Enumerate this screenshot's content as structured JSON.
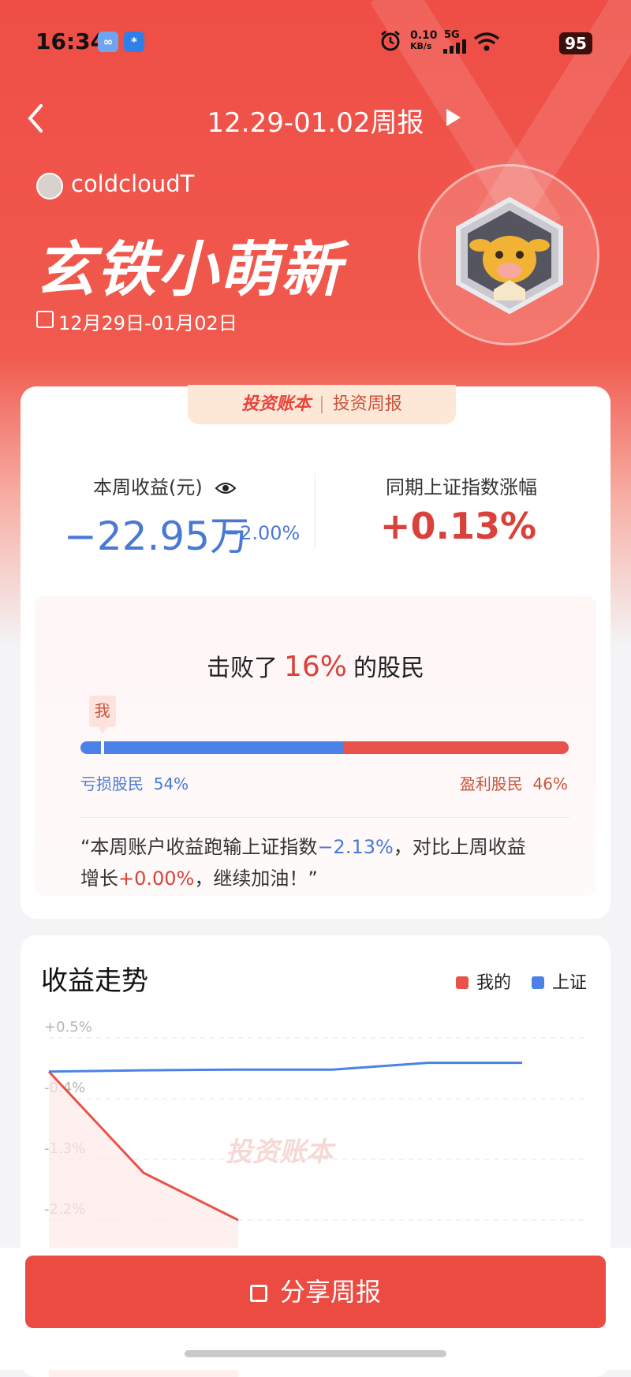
{
  "status_bar": {
    "time": "16:34",
    "net_speed_value": "0.10",
    "net_speed_unit": "KB/s",
    "network": "5G",
    "battery": "95"
  },
  "nav": {
    "title": "12.29-01.02周报"
  },
  "profile": {
    "username": "coldcloudT",
    "rank": "玄铁小萌新",
    "date_range": "12月29日-01月02日"
  },
  "summary": {
    "tag_logo": "投资账本",
    "tag_label": "投资周报",
    "week_profit_label": "本周收益(元)",
    "week_profit": "−22.95万",
    "week_profit_pct": "−2.00%",
    "index_label": "同期上证指数涨幅",
    "index_change": "+0.13%"
  },
  "beat": {
    "prefix": "击败了",
    "pct": "16%",
    "suffix": "的股民",
    "me_label": "我",
    "loss_label": "亏损股民",
    "loss_pct": "54%",
    "gain_label": "盈利股民",
    "gain_pct": "46%",
    "loss_fraction": 0.54,
    "me_position_fraction": 0.16
  },
  "quote": {
    "part1": "“本周账户收益跑输上证指数",
    "diff": "−2.13%",
    "part2": "，对比上周收益",
    "part3": "增长",
    "growth": "+0.00%",
    "part4": "，继续加油！”"
  },
  "trend": {
    "title": "收益走势",
    "legend_mine": "我的",
    "legend_sse": "上证",
    "watermark": "投资账本"
  },
  "chart_data": {
    "type": "line",
    "x": [
      0,
      1,
      2,
      3,
      4,
      5
    ],
    "ytick_labels": [
      "+0.5%",
      "-0.4%",
      "-1.3%",
      "-2.2%"
    ],
    "ytick_values": [
      0.5,
      -0.4,
      -1.3,
      -2.2
    ],
    "series": [
      {
        "name": "我的",
        "color": "#e8524a",
        "values": [
          -0.0,
          -1.5,
          -2.2
        ]
      },
      {
        "name": "上证",
        "color": "#4c82e8",
        "values": [
          -0.0,
          0.02,
          0.03,
          0.03,
          0.13,
          0.13
        ]
      }
    ],
    "ylim": [
      -2.2,
      0.5
    ]
  },
  "share_button": {
    "label": "分享周报"
  },
  "colors": {
    "accent": "#ec4b42",
    "loss_blue": "#4a79d3",
    "gain_red": "#d9423a"
  }
}
